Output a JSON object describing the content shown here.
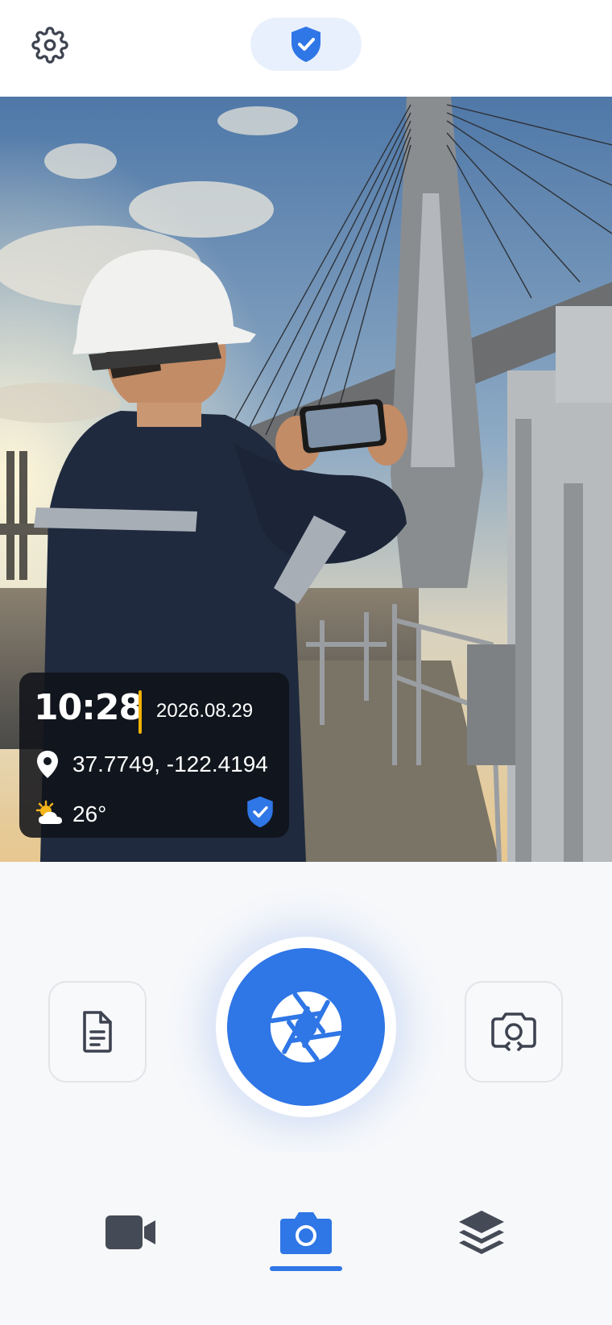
{
  "topbar": {
    "settings_icon": "gear-icon",
    "secure_icon": "shield-check-icon"
  },
  "viewfinder": {
    "scene": "camera-preview"
  },
  "stamp": {
    "time": "10:28",
    "date": "2026.08.29",
    "coordinates": "37.7749, -122.4194",
    "temperature": "26°",
    "location_icon": "map-pin-icon",
    "weather_icon": "partly-sunny-icon",
    "verified_icon": "shield-check-icon",
    "accent_color": "#f2b200"
  },
  "controls": {
    "left_button_icon": "document-icon",
    "shutter_icon": "aperture-icon",
    "right_button_icon": "camera-switch-icon",
    "accent_color": "#2f76e6"
  },
  "bottom_nav": {
    "items": [
      {
        "icon": "video-camera-icon",
        "active": false
      },
      {
        "icon": "camera-icon",
        "active": true
      },
      {
        "icon": "layers-icon",
        "active": false
      }
    ]
  }
}
